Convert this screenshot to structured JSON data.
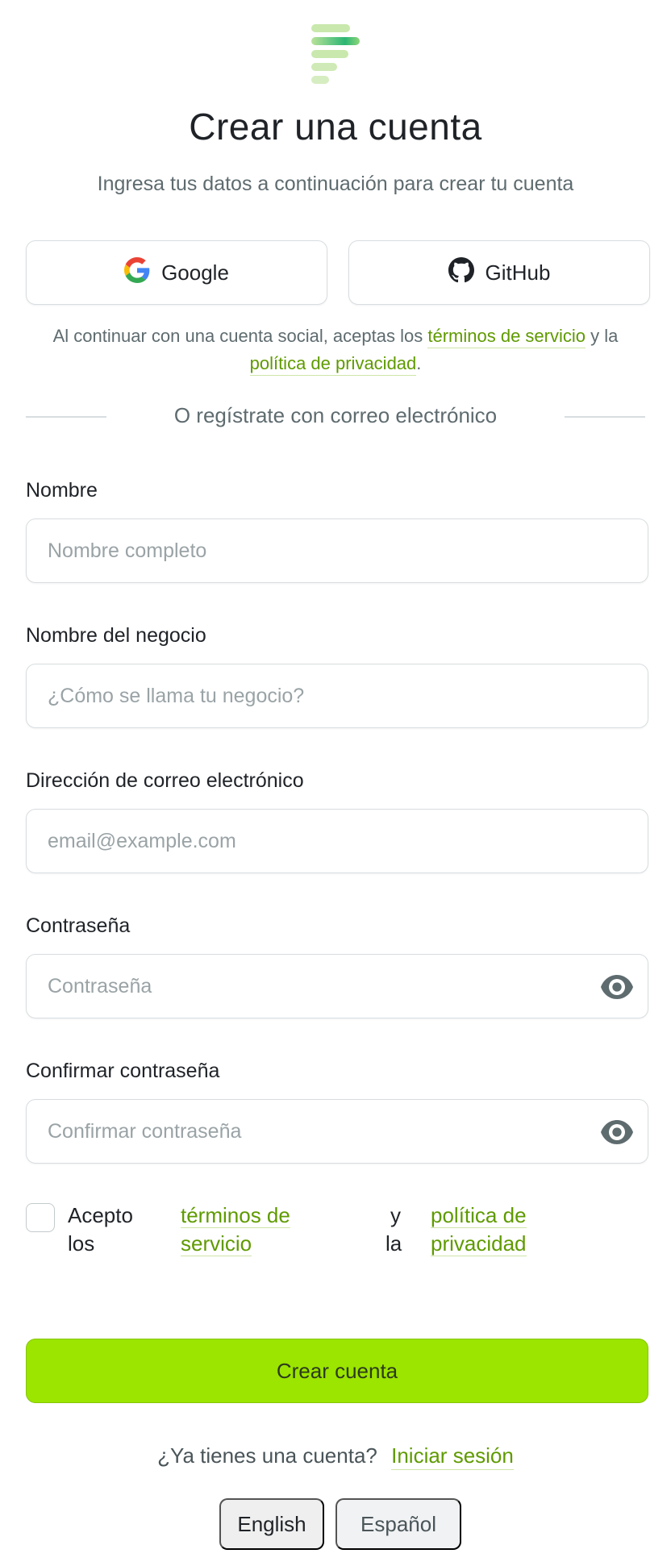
{
  "header": {
    "title": "Crear una cuenta",
    "subtitle": "Ingresa tus datos a continuación para crear tu cuenta"
  },
  "social": {
    "google_label": "Google",
    "github_label": "GitHub",
    "note_prefix": "Al continuar con una cuenta social, aceptas los",
    "terms_link": "términos de servicio",
    "note_middle": "y la",
    "privacy_link": "política de privacidad",
    "note_suffix": "."
  },
  "divider_text": "O regístrate con correo electrónico",
  "form": {
    "name": {
      "label": "Nombre",
      "placeholder": "Nombre completo",
      "value": ""
    },
    "business": {
      "label": "Nombre del negocio",
      "placeholder": "¿Cómo se llama tu negocio?",
      "value": ""
    },
    "email": {
      "label": "Dirección de correo electrónico",
      "placeholder": "email@example.com",
      "value": ""
    },
    "password": {
      "label": "Contraseña",
      "placeholder": "Contraseña",
      "value": ""
    },
    "confirm": {
      "label": "Confirmar contraseña",
      "placeholder": "Confirmar contraseña",
      "value": ""
    }
  },
  "terms": {
    "word1": "Acepto",
    "word2": "los",
    "terms_line1": "términos de",
    "terms_line2": "servicio",
    "word3": "y",
    "word4": "la",
    "privacy_line1": "política de",
    "privacy_line2": "privacidad",
    "checked": false
  },
  "submit_label": "Crear cuenta",
  "signin": {
    "prompt": "¿Ya tienes una cuenta?",
    "link": "Iniciar sesión"
  },
  "languages": {
    "english": "English",
    "spanish": "Español",
    "selected": "Español"
  },
  "colors": {
    "accent": "#9be500",
    "link": "#5f9a00",
    "logo_light": "#c4e6a6",
    "logo_dark": "#2bb673"
  },
  "icons": {
    "google": "google-logo-icon",
    "github": "github-logo-icon",
    "eye": "eye-icon",
    "logo": "app-logo"
  }
}
